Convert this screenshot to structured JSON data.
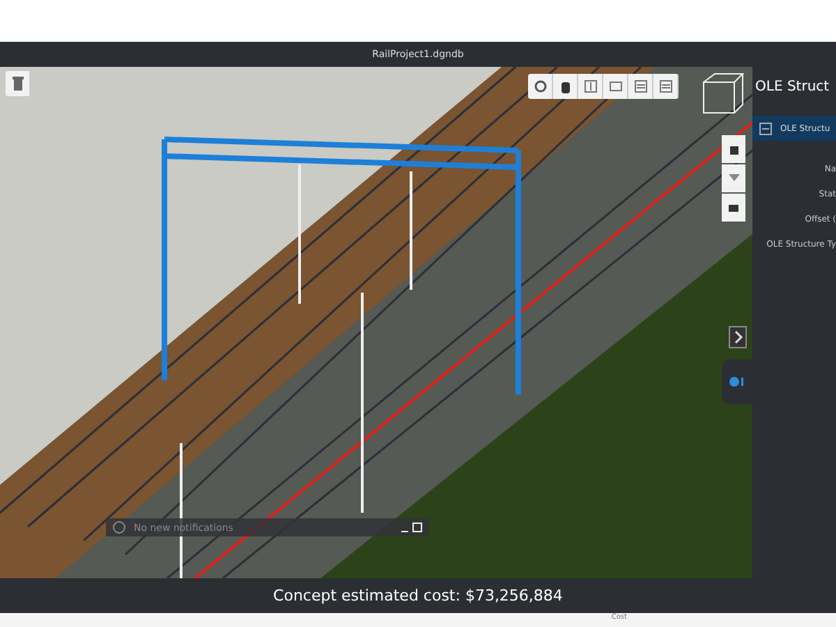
{
  "window": {
    "title": "RailProject1.dgndb"
  },
  "panel": {
    "title": "OLE Struct",
    "section": "OLE Structu",
    "section_expanded": true,
    "fields": [
      "Na",
      "Stat",
      "Offset (",
      "OLE Structure Ty"
    ]
  },
  "notifications": {
    "text": "No new notifications"
  },
  "status_bar": {
    "text": "Concept estimated cost: $73,256,884"
  },
  "footer": {
    "label": "Cost"
  }
}
